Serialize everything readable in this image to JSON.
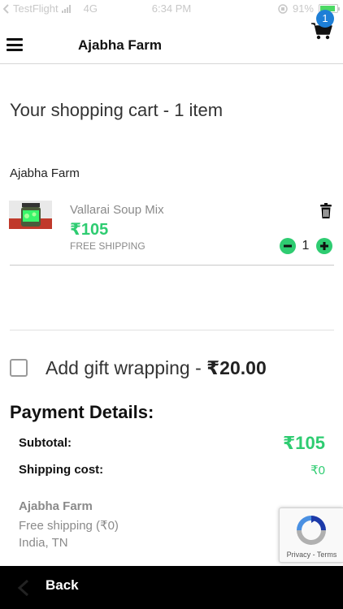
{
  "status_bar": {
    "carrier": "TestFlight",
    "network": "4G",
    "time": "6:34 PM",
    "battery_text": "91%",
    "battery_level": 0.91,
    "icons": [
      "back-arrow-icon",
      "signal-icon",
      "orientation-lock-icon",
      "battery-icon"
    ]
  },
  "header": {
    "title": "Ajabha Farm",
    "cart_count": "1",
    "menu_icon": "hamburger-menu-icon",
    "cart_icon": "shopping-cart-icon"
  },
  "cart": {
    "title": "Your shopping cart - 1 item",
    "store_name": "Ajabha Farm",
    "items": [
      {
        "name": "Vallarai Soup Mix",
        "price": "₹105",
        "shipping": "FREE SHIPPING",
        "quantity": "1"
      }
    ]
  },
  "gift_wrap": {
    "label": "Add gift wrapping - ",
    "price": "₹20.00",
    "checked": false
  },
  "payment": {
    "title": "Payment Details:",
    "subtotal_label": "Subtotal:",
    "subtotal_value": "₹105",
    "shipping_label": "Shipping cost:",
    "shipping_value": "₹0"
  },
  "seller": {
    "name": "Ajabha Farm",
    "shipping": "Free shipping (₹0)",
    "location": "India, TN"
  },
  "recaptcha": {
    "links": "Privacy - Terms"
  },
  "bottom_bar": {
    "back_label": "Back"
  },
  "colors": {
    "accent_green": "#2ecc71",
    "badge_blue": "#1e7fd6",
    "bottom_bar": "#000000"
  }
}
